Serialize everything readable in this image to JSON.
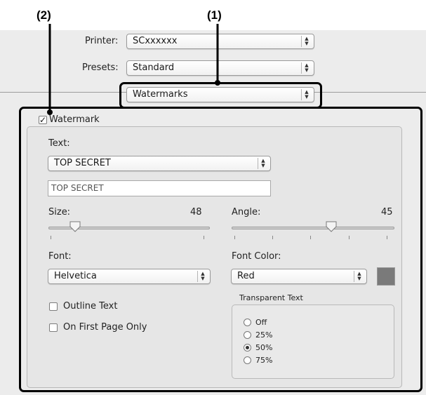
{
  "callouts": {
    "one": "(1)",
    "two": "(2)"
  },
  "printer": {
    "label": "Printer:",
    "value": "SCxxxxxx"
  },
  "presets": {
    "label": "Presets:",
    "value": "Standard"
  },
  "panel_select": {
    "value": "Watermarks"
  },
  "watermark": {
    "checkbox_label": "Watermark",
    "checked": true,
    "text_label": "Text:",
    "text_select": "TOP SECRET",
    "text_field": "TOP SECRET",
    "size_label": "Size:",
    "size_value": "48",
    "angle_label": "Angle:",
    "angle_value": "45",
    "font_label": "Font:",
    "font_value": "Helvetica",
    "font_color_label": "Font Color:",
    "font_color_value": "Red",
    "swatch_color": "#7a7a7a",
    "outline_label": "Outline Text",
    "first_page_label": "On First Page Only",
    "transparent": {
      "title": "Transparent Text",
      "options": [
        "Off",
        "25%",
        "50%",
        "75%"
      ],
      "selected": "50%"
    }
  },
  "check_mark": "✓",
  "stepper_glyphs": {
    "up": "▲",
    "down": "▼"
  }
}
